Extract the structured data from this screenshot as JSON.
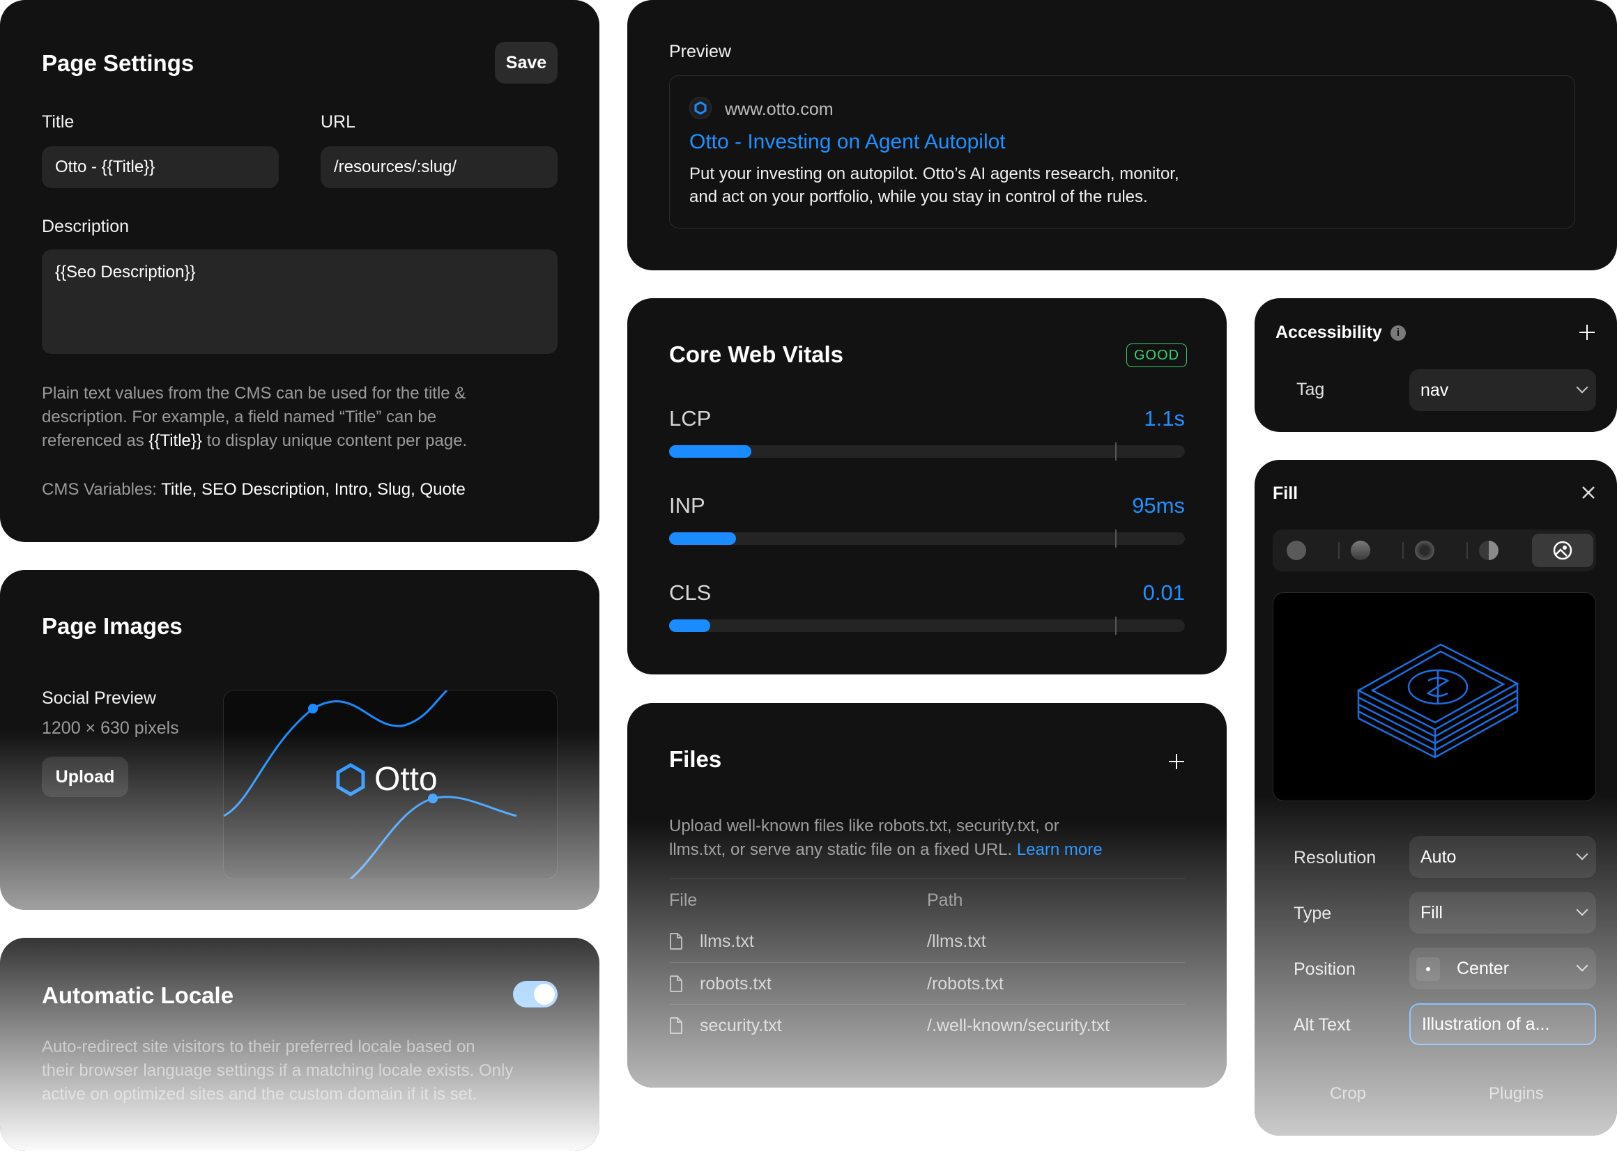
{
  "page_settings": {
    "title": "Page Settings",
    "save_label": "Save",
    "title_label": "Title",
    "title_value": "Otto - {{Title}}",
    "url_label": "URL",
    "url_value": "/resources/:slug/",
    "description_label": "Description",
    "description_value": "{{Seo Description}}",
    "help_line1": "Plain text values from the CMS can be used for the title &",
    "help_line2": "description. For example, a field named “Title” can be",
    "help_line3_pre": "referenced as ",
    "help_line3_var": "{{Title}}",
    "help_line3_post": " to display unique content per page.",
    "cms_label": "CMS Variables: ",
    "cms_values": "Title, SEO Description, Intro, Slug, Quote"
  },
  "page_images": {
    "title": "Page Images",
    "social_label": "Social Preview",
    "dimensions": "1200 × 630 pixels",
    "upload_label": "Upload",
    "brand": "Otto"
  },
  "locale": {
    "title": "Automatic Locale",
    "enabled": true,
    "line1": "Auto-redirect site visitors to their preferred locale based on",
    "line2": "their browser language settings if a matching locale exists. Only",
    "line3": "active on optimized sites and the custom domain if it is set."
  },
  "preview": {
    "label": "Preview",
    "domain": "www.otto.com",
    "headline": "Otto - Investing on Agent Autopilot",
    "desc1": "Put your investing on autopilot. Otto’s AI agents research, monitor,",
    "desc2": "and act on your portfolio, while you stay in control of the rules."
  },
  "vitals": {
    "title": "Core Web Vitals",
    "badge": "GOOD",
    "metrics": [
      {
        "name": "LCP",
        "value": "1.1s",
        "fraction": 0.16
      },
      {
        "name": "INP",
        "value": "95ms",
        "fraction": 0.13
      },
      {
        "name": "CLS",
        "value": "0.01",
        "fraction": 0.08
      }
    ],
    "threshold_fraction": 0.865
  },
  "files": {
    "title": "Files",
    "desc1": "Upload well-known files like robots.txt, security.txt, or",
    "desc2": "llms.txt, or serve any static file on a fixed URL. ",
    "learn_more": "Learn more",
    "col_file": "File",
    "col_path": "Path",
    "rows": [
      {
        "file": "llms.txt",
        "path": "/llms.txt"
      },
      {
        "file": "robots.txt",
        "path": "/robots.txt"
      },
      {
        "file": "security.txt",
        "path": "/.well-known/security.txt"
      }
    ]
  },
  "accessibility": {
    "title": "Accessibility",
    "tag_label": "Tag",
    "tag_value": "nav"
  },
  "fill": {
    "title": "Fill",
    "resolution_label": "Resolution",
    "resolution_value": "Auto",
    "type_label": "Type",
    "type_value": "Fill",
    "position_label": "Position",
    "position_value": "Center",
    "alt_label": "Alt Text",
    "alt_value": "Illustration of a...",
    "tab_crop": "Crop",
    "tab_plugins": "Plugins"
  },
  "colors": {
    "accent": "#1a8cff",
    "link": "#1e90ff",
    "good": "#3ccf6e",
    "card": "#121212"
  }
}
